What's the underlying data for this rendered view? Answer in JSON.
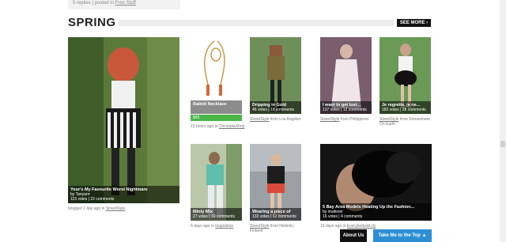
{
  "top": {
    "text": "5 replies | posted in ",
    "link": "Free Stuff"
  },
  "section": {
    "title": "SPRING",
    "see_more": "SEE MORE ›"
  },
  "cards": [
    {
      "title": "Your's My Favourite Worst Nightmare",
      "byline": "by Tanyarrr",
      "stats": "115 votes | 22 comments",
      "below": "blogged 1 day ago in ",
      "below_link": "StreetStyle",
      "below_tail": ""
    },
    {
      "title": "Rabbit Necklace",
      "price": "$45",
      "below": "10 hours ago in ",
      "below_link": "ChictopiaShop",
      "below_tail": ""
    },
    {
      "title": "Dripping in Gold",
      "stats": "46 votes | 16 comments",
      "below": "",
      "below_link": "StreetStyle",
      "below_tail": " from Los Angeles"
    },
    {
      "title": "I want to get lost...",
      "stats": "137 votes | 12 comments",
      "below": "",
      "below_link": "StreetStyle",
      "below_tail": " from Philippines"
    },
    {
      "title": "Je regrette, je ne...",
      "stats": "182 votes | 28 comments",
      "below": "",
      "below_link": "StreetStyle",
      "below_tail": " from Somewhere On Earth"
    },
    {
      "title": "Minty Mix",
      "stats": "27 votes | 10 comments",
      "below": "6 days ago in ",
      "below_link": "Inspiration",
      "below_tail": ""
    },
    {
      "title": "Wearing a piece of",
      "stats": "132 votes | 12 comments",
      "below": "",
      "below_link": "StreetStyle",
      "below_tail": " from Helsinki, Finland"
    },
    {
      "title": "5 Bay Area Models Heating Up the Fashion...",
      "byline": "by imafever",
      "stats": "16 votes | 4 comments",
      "below": "19 days ago in ",
      "below_link": "Everybodyisit.dy",
      "below_tail": ""
    }
  ],
  "footer": {
    "about": "About Us",
    "to_top": "Take Me to the Top ▲"
  }
}
